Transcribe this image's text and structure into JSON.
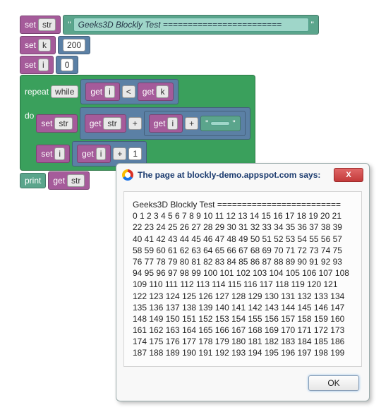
{
  "blocks": {
    "set": "set",
    "get": "get",
    "repeat": "repeat",
    "while": "while",
    "do": "do",
    "print": "print",
    "plus": "+",
    "lt": "<",
    "quote": "\"",
    "var_str": "str",
    "var_k": "k",
    "var_i": "i",
    "val_200": "200",
    "val_0": "0",
    "val_1": "1",
    "str_literal": "  Geeks3D Blockly Test ========================",
    "space_literal": " "
  },
  "dialog": {
    "title": "The page at blockly-demo.appspot.com says:",
    "close": "X",
    "ok": "OK",
    "body": "Geeks3D Blockly Test =========================\n0 1 2 3 4 5 6 7 8 9 10 11 12 13 14 15 16 17 18 19 20 21 22 23 24 25 26 27 28 29 30 31 32 33 34 35 36 37 38 39 40 41 42 43 44 45 46 47 48 49 50 51 52 53 54 55 56 57 58 59 60 61 62 63 64 65 66 67 68 69 70 71 72 73 74 75 76 77 78 79 80 81 82 83 84 85 86 87 88 89 90 91 92 93 94 95 96 97 98 99 100 101 102 103 104 105 106 107 108 109 110 111 112 113 114 115 116 117 118 119 120 121 122 123 124 125 126 127 128 129 130 131 132 133 134 135 136 137 138 139 140 141 142 143 144 145 146 147 148 149 150 151 152 153 154 155 156 157 158 159 160 161 162 163 164 165 166 167 168 169 170 171 172 173 174 175 176 177 178 179 180 181 182 183 184 185 186 187 188 189 190 191 192 193 194 195 196 197 198 199"
  }
}
